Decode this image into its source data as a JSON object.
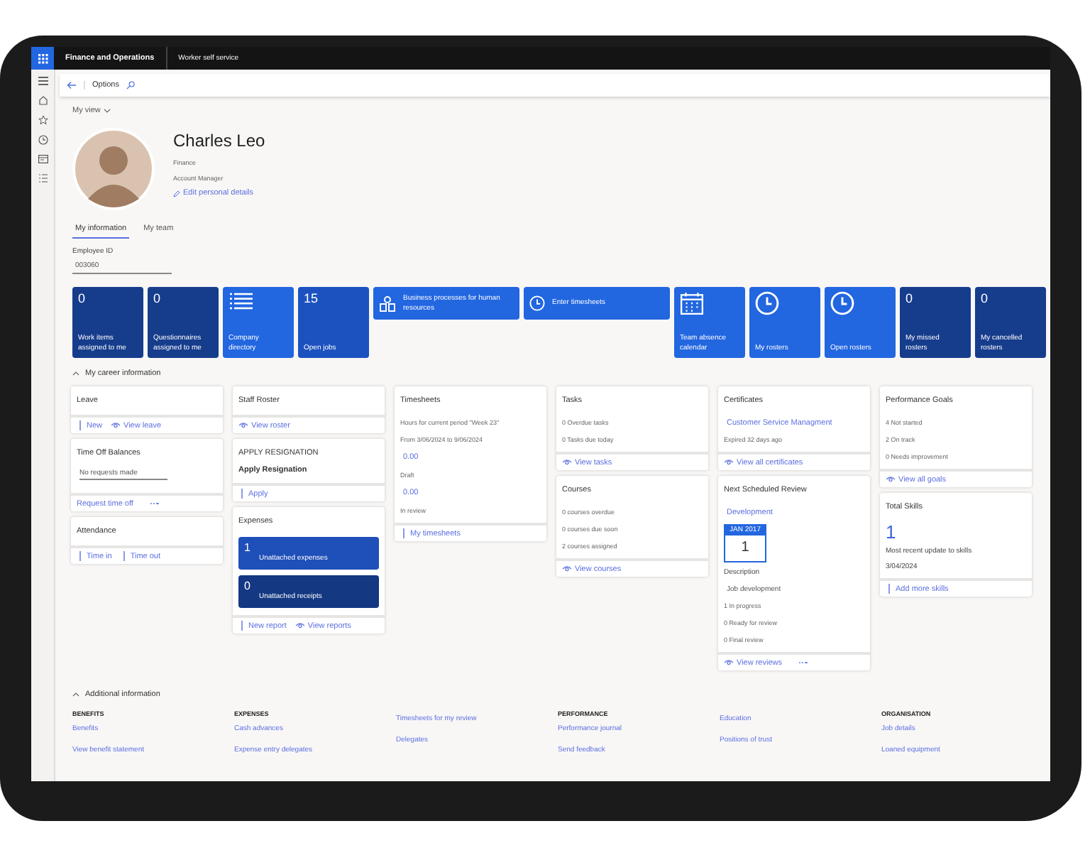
{
  "top_bar": {
    "app_name": "Finance and Operations",
    "module": "Worker self service"
  },
  "options_bar": {
    "label": "Options"
  },
  "view_selector": {
    "label": "My view"
  },
  "profile": {
    "name": "Charles Leo",
    "department": "Finance",
    "job_title": "Account Manager",
    "edit_link": "Edit personal details"
  },
  "tabs": [
    {
      "label": "My information",
      "selected": true
    },
    {
      "label": "My team",
      "selected": false
    }
  ],
  "employee_id": {
    "label": "Employee ID",
    "value": "003060"
  },
  "tiles": [
    {
      "kind": "count",
      "count": "0",
      "label": "Work items assigned to me",
      "color": "#163c8c"
    },
    {
      "kind": "count",
      "count": "0",
      "label": "Questionnaires assigned to me",
      "color": "#163c8c"
    },
    {
      "kind": "directory",
      "label": "Company directory",
      "color": "#2266e0"
    },
    {
      "kind": "count",
      "count": "15",
      "label": "Open jobs",
      "color": "#1c52c0"
    },
    {
      "kind": "process",
      "label": "Business processes for human resources",
      "color": "#2266e0"
    },
    {
      "kind": "timesheet",
      "label": "Enter timesheets",
      "color": "#2266e0"
    },
    {
      "kind": "calendar",
      "label": "Team absence calendar",
      "color": "#2266e0"
    },
    {
      "kind": "roster",
      "label": "My rosters",
      "color": "#2266e0"
    },
    {
      "kind": "roster",
      "label": "Open rosters",
      "color": "#2266e0"
    },
    {
      "kind": "count",
      "count": "0",
      "label": "My missed rosters",
      "color": "#163c8c"
    },
    {
      "kind": "count",
      "count": "0",
      "label": "My cancelled rosters",
      "color": "#163c8c"
    }
  ],
  "career_section": {
    "title": "My career information",
    "expanded": true,
    "columns": [
      [
        {
          "title": "Leave",
          "actions": [
            {
              "kind": "add",
              "label": "New"
            },
            {
              "kind": "view",
              "label": "View leave"
            }
          ]
        },
        {
          "title": "Time Off Balances",
          "body": [
            {
              "kind": "field",
              "text": "No requests made"
            }
          ],
          "actions": [
            {
              "kind": "plain",
              "label": "Request time off"
            },
            {
              "kind": "more"
            }
          ]
        },
        {
          "title": "Attendance",
          "actions": [
            {
              "kind": "add",
              "label": "Time in"
            },
            {
              "kind": "add",
              "label": "Time out"
            }
          ]
        }
      ],
      [
        {
          "title": "Staff Roster",
          "actions": [
            {
              "kind": "view",
              "label": "View roster"
            }
          ]
        },
        {
          "title": "APPLY RESIGNATION",
          "body": [
            {
              "kind": "heading",
              "text": "Apply Resignation"
            }
          ],
          "actions": [
            {
              "kind": "add",
              "label": "Apply"
            }
          ]
        },
        {
          "title": "Expenses",
          "body": [
            {
              "kind": "tile",
              "count": "1",
              "text": "Unattached expenses",
              "color": "#1f4fb8"
            },
            {
              "kind": "tile",
              "count": "0",
              "text": "Unattached receipts",
              "color": "#143882"
            }
          ],
          "actions": [
            {
              "kind": "add",
              "label": "New report"
            },
            {
              "kind": "view",
              "label": "View reports"
            }
          ]
        }
      ],
      [
        {
          "title": "Timesheets",
          "body": [
            {
              "kind": "text",
              "text": "Hours for current period \"Week 23\""
            },
            {
              "kind": "text",
              "text": "From 3/06/2024 to 9/06/2024"
            },
            {
              "kind": "value",
              "text": "0.00"
            },
            {
              "kind": "text",
              "text": "Draft"
            },
            {
              "kind": "value",
              "text": "0.00"
            },
            {
              "kind": "text",
              "text": "In review"
            }
          ],
          "actions": [
            {
              "kind": "add",
              "label": "My timesheets"
            }
          ]
        }
      ],
      [
        {
          "title": "Tasks",
          "body": [
            {
              "kind": "text",
              "text": "0 Overdue tasks"
            },
            {
              "kind": "text",
              "text": "0 Tasks due today"
            }
          ],
          "actions": [
            {
              "kind": "view",
              "label": "View tasks"
            }
          ]
        },
        {
          "title": "Courses",
          "body": [
            {
              "kind": "text",
              "text": "0 courses overdue"
            },
            {
              "kind": "text",
              "text": "0 courses due soon"
            },
            {
              "kind": "text",
              "text": "2 courses assigned"
            }
          ],
          "actions": [
            {
              "kind": "view",
              "label": "View courses"
            }
          ]
        }
      ],
      [
        {
          "title": "Certificates",
          "body": [
            {
              "kind": "link",
              "text": "Customer Service Managment"
            },
            {
              "kind": "text",
              "text": "Expired 32 days ago"
            }
          ],
          "actions": [
            {
              "kind": "view",
              "label": "View all certificates"
            }
          ]
        },
        {
          "title": "Next Scheduled Review",
          "body": [
            {
              "kind": "link",
              "text": "Development"
            },
            {
              "kind": "calendar",
              "month": "JAN 2017",
              "day": "1"
            },
            {
              "kind": "label",
              "text": "Description"
            },
            {
              "kind": "detail",
              "text": "Job development"
            },
            {
              "kind": "text",
              "text": "1 In progress"
            },
            {
              "kind": "text",
              "text": "0 Ready for review"
            },
            {
              "kind": "text",
              "text": "0 Final review"
            }
          ],
          "actions": [
            {
              "kind": "view",
              "label": "View reviews"
            },
            {
              "kind": "more"
            }
          ]
        }
      ],
      [
        {
          "title": "Performance Goals",
          "body": [
            {
              "kind": "text",
              "text": "4 Not started"
            },
            {
              "kind": "text",
              "text": "2 On track"
            },
            {
              "kind": "text",
              "text": "0 Needs improvement"
            }
          ],
          "actions": [
            {
              "kind": "view",
              "label": "View all goals"
            }
          ]
        },
        {
          "title": "Total Skills",
          "body": [
            {
              "kind": "big",
              "text": "1"
            },
            {
              "kind": "label",
              "text": "Most recent update to skills"
            },
            {
              "kind": "label",
              "text": "3/04/2024"
            }
          ],
          "actions": [
            {
              "kind": "add",
              "label": "Add more skills"
            }
          ]
        }
      ]
    ]
  },
  "additional_section": {
    "title": "Additional information",
    "expanded": true,
    "columns": [
      {
        "header": "BENEFITS",
        "links": [
          "Benefits",
          "View benefit statement"
        ]
      },
      {
        "header": "EXPENSES",
        "links": [
          "Cash advances",
          "Expense entry delegates"
        ]
      },
      {
        "links": [
          "Timesheets for my review",
          "Delegates"
        ]
      },
      {
        "header": "PERFORMANCE",
        "links": [
          "Performance journal",
          "Send feedback"
        ]
      },
      {
        "links": [
          "Education",
          "Positions of trust"
        ]
      },
      {
        "header": "ORGANISATION",
        "links": [
          "Job details",
          "Loaned equipment"
        ]
      }
    ]
  }
}
